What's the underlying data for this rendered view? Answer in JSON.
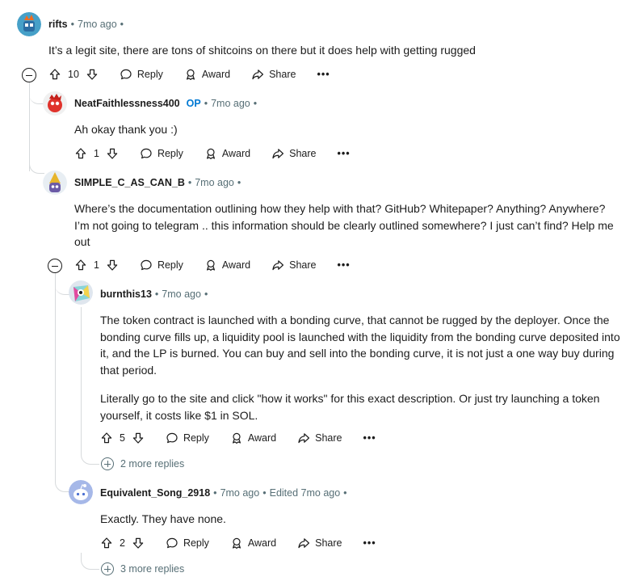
{
  "comments": [
    {
      "username": "rifts",
      "time": "7mo ago",
      "text": "It’s a legit site, there are tons of shitcoins on there but it does help with getting rugged",
      "votes": "10"
    },
    {
      "username": "NeatFaithlessness400",
      "op": "OP",
      "time": "7mo ago",
      "text": "Ah okay thank you :)",
      "votes": "1"
    },
    {
      "username": "SIMPLE_C_AS_CAN_B",
      "time": "7mo ago",
      "text": "Where’s the documentation outlining how they help with that? GitHub? Whitepaper? Anything? Anywhere? I’m not going to telegram .. this information should be clearly outlined somewhere? I just can’t find? Help me out",
      "votes": "1"
    },
    {
      "username": "burnthis13",
      "time": "7mo ago",
      "text_p1": "The token contract is launched with a bonding curve, that cannot be rugged by the deployer. Once the bonding curve fills up, a liquidity pool is launched with the liquidity from the bonding curve deposited into it, and the LP is burned. You can buy and sell into the bonding curve, it is not just a one way buy during that period.",
      "text_p2": "Literally go to the site and click \"how it works\" for this exact description. Or just try launching a token yourself, it costs like $1 in SOL.",
      "votes": "5",
      "more_replies": "2 more replies"
    },
    {
      "username": "Equivalent_Song_2918",
      "time": "7mo ago",
      "edited": "Edited 7mo ago",
      "text": "Exactly. They have none.",
      "votes": "2",
      "more_replies": "3 more replies"
    }
  ],
  "labels": {
    "reply": "Reply",
    "award": "Award",
    "share": "Share",
    "overflow": "•••",
    "sep": "•"
  },
  "colors": {
    "meta": "#576f76",
    "op": "#0079d3",
    "line": "#d7dadc"
  }
}
